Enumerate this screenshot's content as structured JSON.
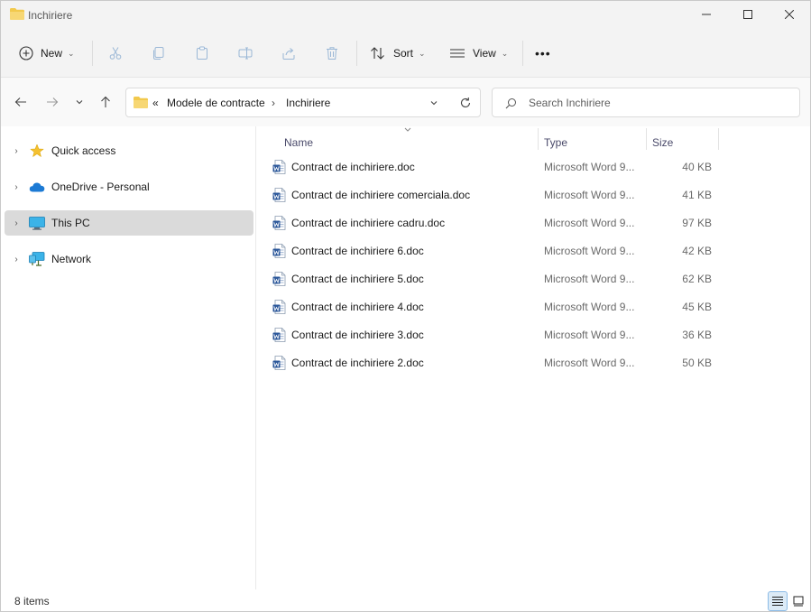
{
  "window": {
    "title": "Inchiriere"
  },
  "commands": {
    "new_label": "New",
    "sort_label": "Sort",
    "view_label": "View",
    "more_label": "•••"
  },
  "address": {
    "overflow": "«",
    "crumbs": [
      "Modele de contracte",
      "Inchiriere"
    ]
  },
  "search": {
    "placeholder": "Search Inchiriere"
  },
  "sidebar": {
    "items": [
      {
        "label": "Quick access",
        "icon": "star-icon",
        "selected": false
      },
      {
        "label": "OneDrive - Personal",
        "icon": "cloud-icon",
        "selected": false
      },
      {
        "label": "This PC",
        "icon": "monitor-icon",
        "selected": true
      },
      {
        "label": "Network",
        "icon": "network-icon",
        "selected": false
      }
    ]
  },
  "columns": {
    "name": "Name",
    "type": "Type",
    "size": "Size"
  },
  "files": [
    {
      "name": "Contract de inchiriere.doc",
      "type": "Microsoft Word 9...",
      "size": "40 KB"
    },
    {
      "name": "Contract de inchiriere comerciala.doc",
      "type": "Microsoft Word 9...",
      "size": "41 KB"
    },
    {
      "name": "Contract de inchiriere cadru.doc",
      "type": "Microsoft Word 9...",
      "size": "97 KB"
    },
    {
      "name": "Contract de inchiriere 6.doc",
      "type": "Microsoft Word 9...",
      "size": "42 KB"
    },
    {
      "name": "Contract de inchiriere 5.doc",
      "type": "Microsoft Word 9...",
      "size": "62 KB"
    },
    {
      "name": "Contract de inchiriere 4.doc",
      "type": "Microsoft Word 9...",
      "size": "45 KB"
    },
    {
      "name": "Contract de inchiriere 3.doc",
      "type": "Microsoft Word 9...",
      "size": "36 KB"
    },
    {
      "name": "Contract de inchiriere 2.doc",
      "type": "Microsoft Word 9...",
      "size": "50 KB"
    }
  ],
  "status": {
    "count": "8 items"
  },
  "colors": {
    "folder": "#f2c94c",
    "word_blue": "#2b579a",
    "selected_bg": "#dadada"
  }
}
